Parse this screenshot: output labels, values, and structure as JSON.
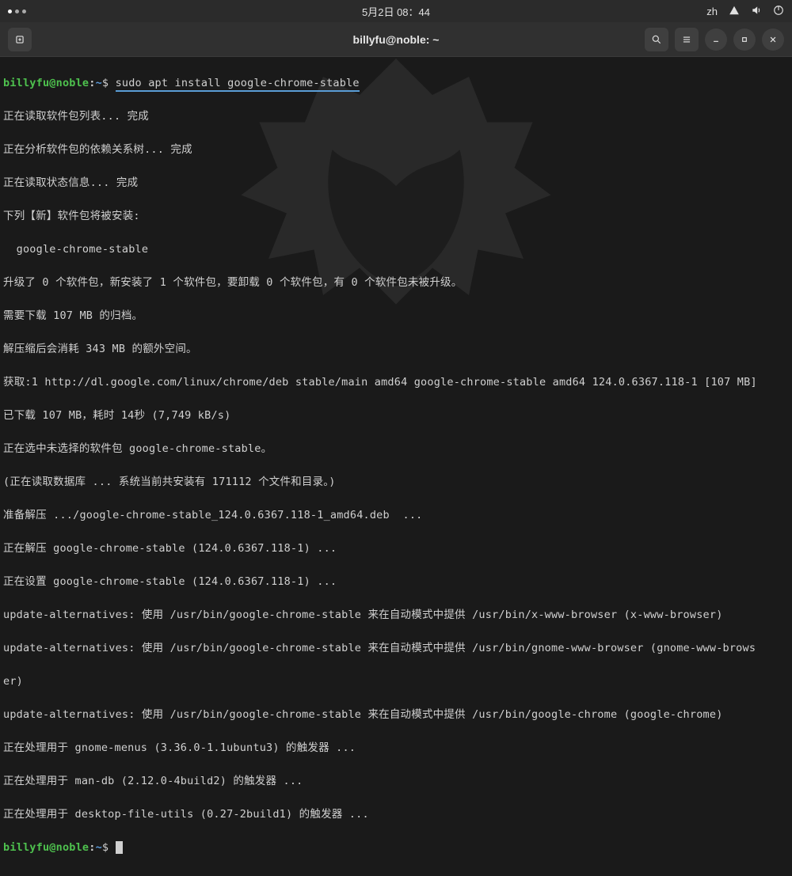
{
  "system_bar": {
    "datetime": "5月2日 08：44",
    "lang": "zh"
  },
  "window": {
    "title": "billyfu@noble: ~"
  },
  "prompt": {
    "user": "billyfu",
    "host": "noble",
    "path": "~",
    "sep": "@",
    "dollar": "$"
  },
  "command": "sudo apt install google-chrome-stable",
  "lines": [
    "正在读取软件包列表... 完成",
    "正在分析软件包的依赖关系树... 完成",
    "正在读取状态信息... 完成",
    "下列【新】软件包将被安装:",
    "  google-chrome-stable",
    "升级了 0 个软件包，新安装了 1 个软件包，要卸载 0 个软件包，有 0 个软件包未被升级。",
    "需要下载 107 MB 的归档。",
    "解压缩后会消耗 343 MB 的额外空间。",
    "获取:1 http://dl.google.com/linux/chrome/deb stable/main amd64 google-chrome-stable amd64 124.0.6367.118-1 [107 MB]",
    "已下载 107 MB，耗时 14秒 (7,749 kB/s)",
    "正在选中未选择的软件包 google-chrome-stable。",
    "(正在读取数据库 ... 系统当前共安装有 171112 个文件和目录。)",
    "准备解压 .../google-chrome-stable_124.0.6367.118-1_amd64.deb  ...",
    "正在解压 google-chrome-stable (124.0.6367.118-1) ...",
    "正在设置 google-chrome-stable (124.0.6367.118-1) ...",
    "update-alternatives: 使用 /usr/bin/google-chrome-stable 来在自动模式中提供 /usr/bin/x-www-browser (x-www-browser)",
    "update-alternatives: 使用 /usr/bin/google-chrome-stable 来在自动模式中提供 /usr/bin/gnome-www-browser (gnome-www-brows",
    "er)",
    "update-alternatives: 使用 /usr/bin/google-chrome-stable 来在自动模式中提供 /usr/bin/google-chrome (google-chrome)",
    "正在处理用于 gnome-menus (3.36.0-1.1ubuntu3) 的触发器 ...",
    "正在处理用于 man-db (2.12.0-4build2) 的触发器 ...",
    "正在处理用于 desktop-file-utils (0.27-2build1) 的触发器 ..."
  ]
}
